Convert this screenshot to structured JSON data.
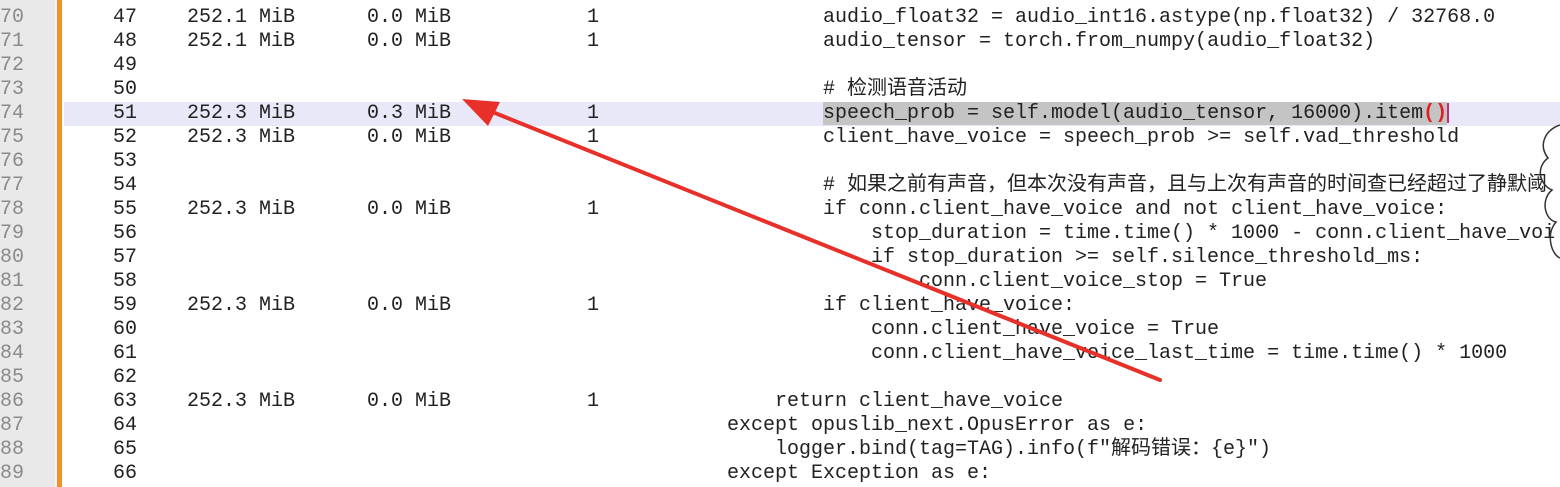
{
  "rows": [
    {
      "ln": "70",
      "num": "47",
      "mem": "252.1 MiB",
      "inc": "0.0 MiB",
      "occ": "1",
      "indent": 2,
      "code": "audio_float32 = audio_int16.astype(np.float32) / 32768.0"
    },
    {
      "ln": "71",
      "num": "48",
      "mem": "252.1 MiB",
      "inc": "0.0 MiB",
      "occ": "1",
      "indent": 2,
      "code": "audio_tensor = torch.from_numpy(audio_float32)"
    },
    {
      "ln": "72",
      "num": "49",
      "mem": "",
      "inc": "",
      "occ": "",
      "indent": 2,
      "code": ""
    },
    {
      "ln": "73",
      "num": "50",
      "mem": "",
      "inc": "",
      "occ": "",
      "indent": 2,
      "code": "# 检测语音活动"
    },
    {
      "ln": "74",
      "num": "51",
      "mem": "252.3 MiB",
      "inc": "0.3 MiB",
      "occ": "1",
      "indent": 2,
      "code": "speech_prob = self.model(audio_tensor, 16000).item",
      "code_tail": "()",
      "highlighted": true
    },
    {
      "ln": "75",
      "num": "52",
      "mem": "252.3 MiB",
      "inc": "0.0 MiB",
      "occ": "1",
      "indent": 2,
      "code": "client_have_voice = speech_prob >= self.vad_threshold"
    },
    {
      "ln": "76",
      "num": "53",
      "mem": "",
      "inc": "",
      "occ": "",
      "indent": 2,
      "code": ""
    },
    {
      "ln": "77",
      "num": "54",
      "mem": "",
      "inc": "",
      "occ": "",
      "indent": 2,
      "code": "# 如果之前有声音，但本次没有声音，且与上次有声音的时间查已经超过了静默阈"
    },
    {
      "ln": "78",
      "num": "55",
      "mem": "252.3 MiB",
      "inc": "0.0 MiB",
      "occ": "1",
      "indent": 2,
      "code": "if conn.client_have_voice and not client_have_voice:"
    },
    {
      "ln": "79",
      "num": "56",
      "mem": "",
      "inc": "",
      "occ": "",
      "indent": 3,
      "code": "stop_duration = time.time() * 1000 - conn.client_have_voi"
    },
    {
      "ln": "80",
      "num": "57",
      "mem": "",
      "inc": "",
      "occ": "",
      "indent": 3,
      "code": "if stop_duration >= self.silence_threshold_ms:"
    },
    {
      "ln": "81",
      "num": "58",
      "mem": "",
      "inc": "",
      "occ": "",
      "indent": 4,
      "code": "conn.client_voice_stop = True"
    },
    {
      "ln": "82",
      "num": "59",
      "mem": "252.3 MiB",
      "inc": "0.0 MiB",
      "occ": "1",
      "indent": 2,
      "code": "if client_have_voice:"
    },
    {
      "ln": "83",
      "num": "60",
      "mem": "",
      "inc": "",
      "occ": "",
      "indent": 3,
      "code": "conn.client_have_voice = True"
    },
    {
      "ln": "84",
      "num": "61",
      "mem": "",
      "inc": "",
      "occ": "",
      "indent": 3,
      "code": "conn.client_have_voice_last_time = time.time() * 1000"
    },
    {
      "ln": "85",
      "num": "62",
      "mem": "",
      "inc": "",
      "occ": "",
      "indent": 2,
      "code": ""
    },
    {
      "ln": "86",
      "num": "63",
      "mem": "252.3 MiB",
      "inc": "0.0 MiB",
      "occ": "1",
      "indent": 1,
      "code": "return client_have_voice"
    },
    {
      "ln": "87",
      "num": "64",
      "mem": "",
      "inc": "",
      "occ": "",
      "indent": 0,
      "code": "except opuslib_next.OpusError as e:"
    },
    {
      "ln": "88",
      "num": "65",
      "mem": "",
      "inc": "",
      "occ": "",
      "indent": 1,
      "code": "logger.bind(tag=TAG).info(f\"解码错误：{e}\")"
    },
    {
      "ln": "89",
      "num": "66",
      "mem": "",
      "inc": "",
      "occ": "",
      "indent": 0,
      "code": "except Exception as e:"
    }
  ],
  "colors": {
    "accent_bar": "#f0902a",
    "arrow": "#e8302a",
    "highlight_row": "#e8e8f8",
    "selection": "#c4c4c4"
  }
}
